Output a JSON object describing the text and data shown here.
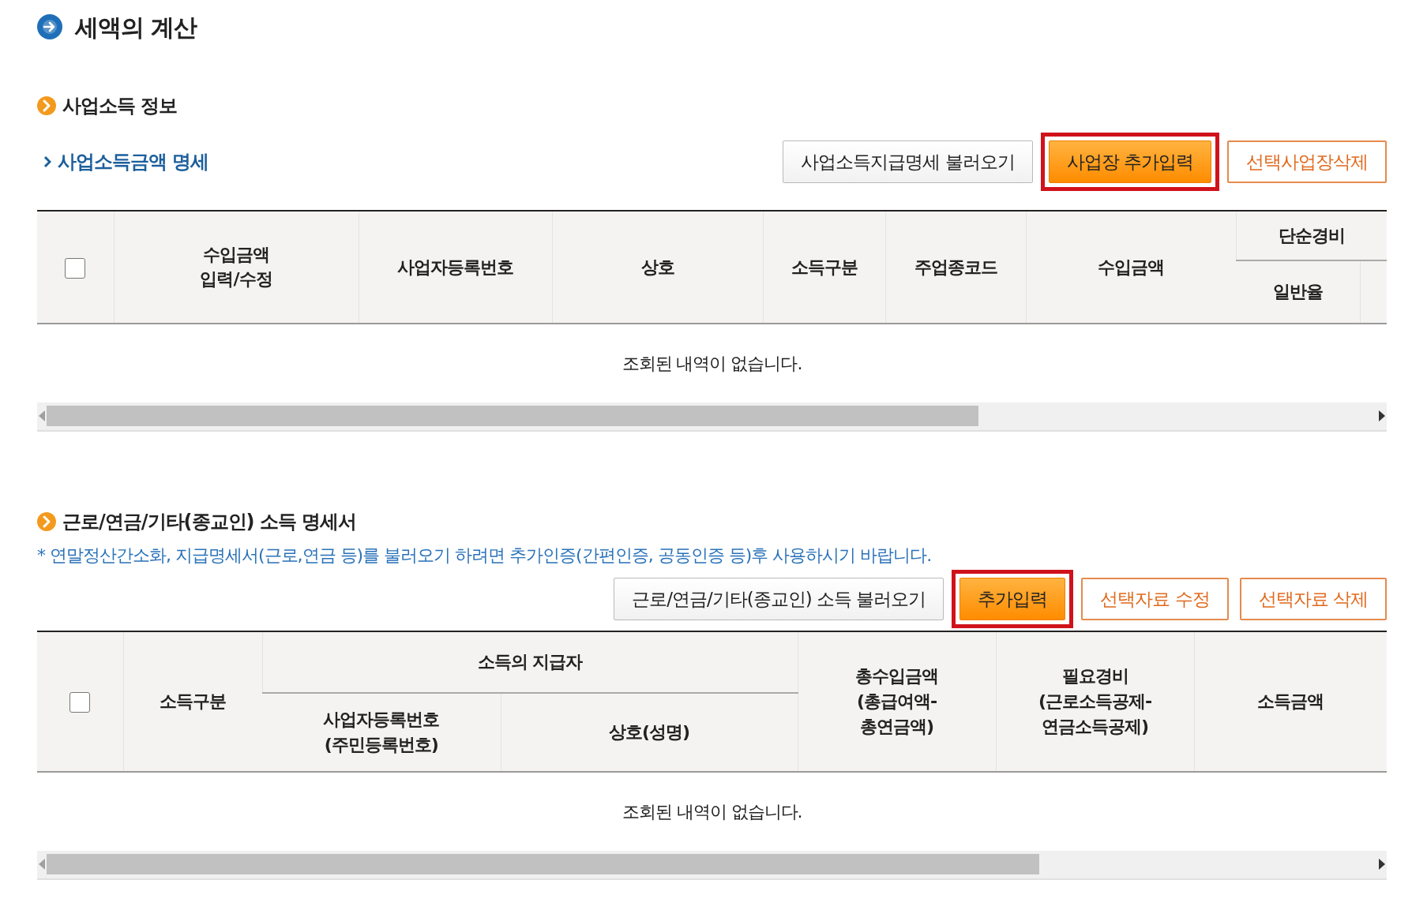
{
  "page_title": "세액의 계산",
  "sections": [
    {
      "title": "사업소득 정보",
      "subtitle": "사업소득금액 명세",
      "buttons": [
        {
          "label": "사업소득지급명세 불러오기",
          "kind": "default",
          "highlighted": false
        },
        {
          "label": "사업장 추가입력",
          "kind": "primary",
          "highlighted": true
        },
        {
          "label": "선택사업장삭제",
          "kind": "outline",
          "highlighted": false
        }
      ],
      "table": {
        "columns": [
          {
            "kind": "checkbox",
            "checked": false
          },
          {
            "kind": "text",
            "label": "수입금액\n입력/수정"
          },
          {
            "kind": "text",
            "label": "사업자등록번호"
          },
          {
            "kind": "text",
            "label": "상호"
          },
          {
            "kind": "text",
            "label": "소득구분"
          },
          {
            "kind": "text",
            "label": "주업종코드"
          },
          {
            "kind": "text",
            "label": "수입금액"
          },
          {
            "kind": "group",
            "label": "단순경비",
            "truncated": true,
            "children": [
              {
                "kind": "text",
                "label": "일반율"
              }
            ]
          }
        ],
        "empty_message": "조회된 내역이 없습니다."
      }
    },
    {
      "title": "근로/연금/기타(종교인) 소득 명세서",
      "note": "* 연말정산간소화, 지급명세서(근로,연금 등)를 불러오기 하려면 추가인증(간편인증, 공동인증 등)후 사용하시기 바랍니다.",
      "buttons": [
        {
          "label": "근로/연금/기타(종교인) 소득 불러오기",
          "kind": "default",
          "highlighted": false
        },
        {
          "label": "추가입력",
          "kind": "primary",
          "highlighted": true
        },
        {
          "label": "선택자료 수정",
          "kind": "outline",
          "highlighted": false
        },
        {
          "label": "선택자료 삭제",
          "kind": "outline",
          "highlighted": false
        }
      ],
      "table": {
        "columns": [
          {
            "kind": "checkbox",
            "checked": false
          },
          {
            "kind": "text",
            "label": "소득구분"
          },
          {
            "kind": "group",
            "label": "소득의 지급자",
            "truncated": false,
            "children": [
              {
                "kind": "text",
                "label": "사업자등록번호\n(주민등록번호)"
              },
              {
                "kind": "text",
                "label": "상호(성명)"
              }
            ]
          },
          {
            "kind": "text",
            "label": "총수입금액\n(총급여액-\n총연금액)"
          },
          {
            "kind": "text",
            "label": "필요경비\n(근로소득공제-\n연금소득공제)"
          },
          {
            "kind": "text",
            "label": "소득금액"
          }
        ],
        "empty_message": "조회된 내역이 없습니다."
      }
    }
  ]
}
